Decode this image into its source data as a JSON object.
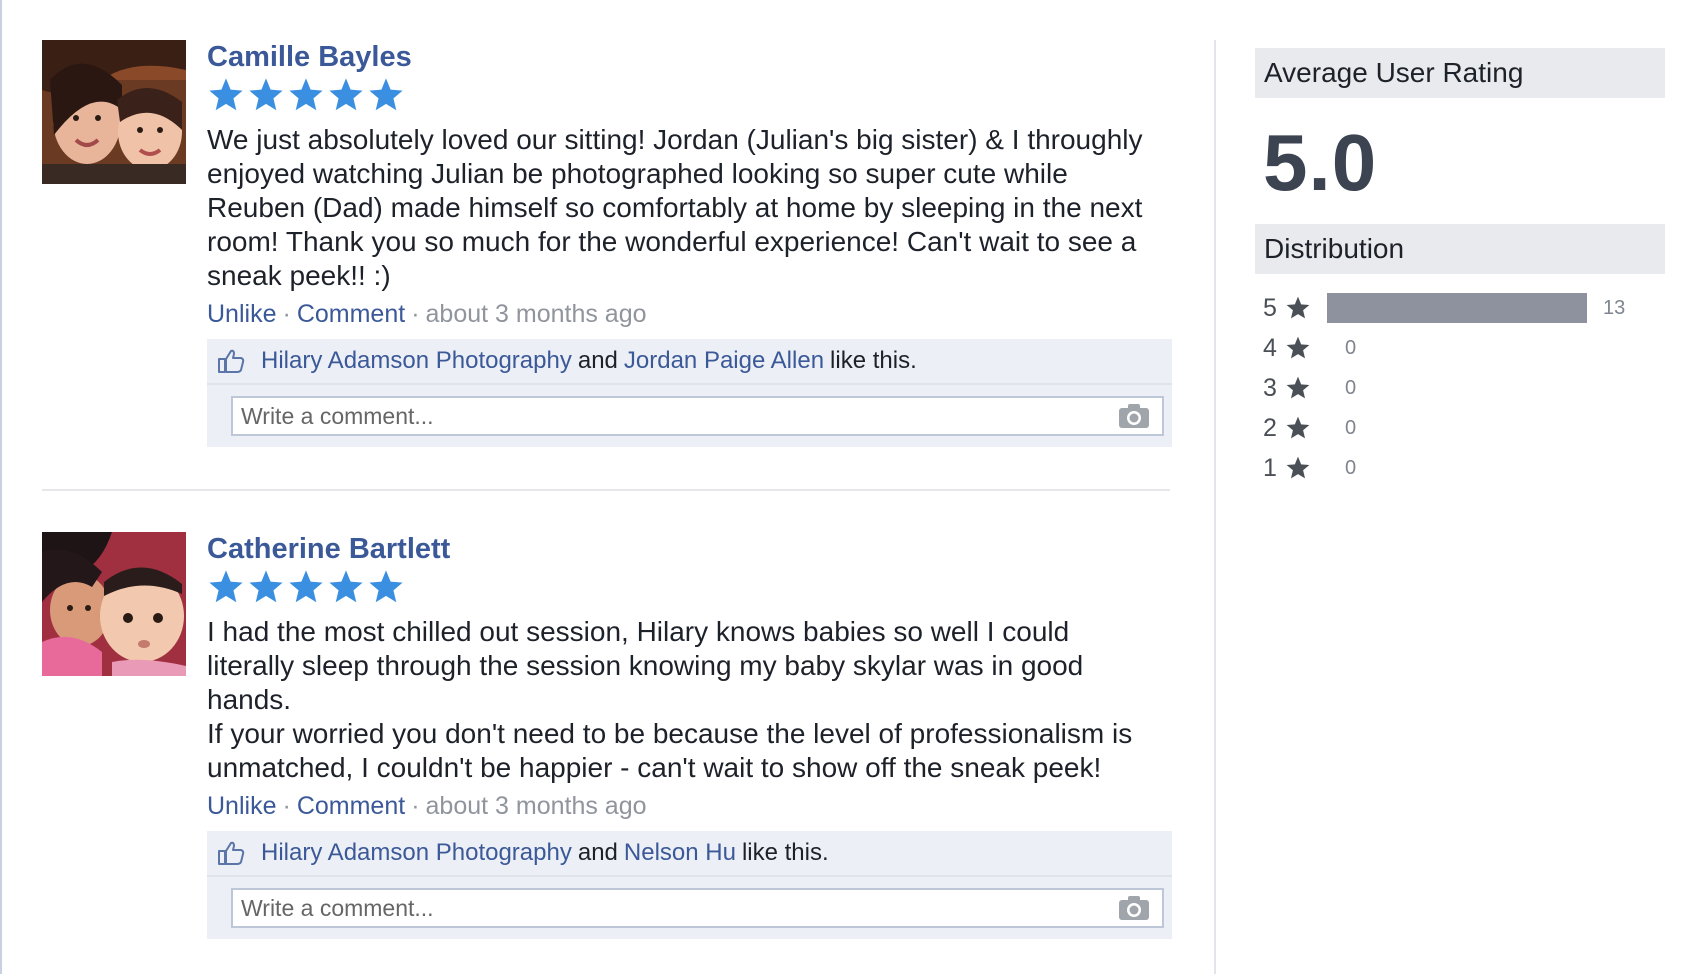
{
  "reviews": [
    {
      "author": "Camille Bayles",
      "rating": 5,
      "text": "We just absolutely loved our sitting! Jordan (Julian's big sister) & I throughly\nenjoyed watching Julian be photographed looking so super cute while\nReuben (Dad) made himself so comfortably at home by sleeping in the next\nroom! Thank you so much for the wonderful experience! Can't wait to see a\nsneak peek!! :)",
      "unlike": "Unlike",
      "comment": "Comment",
      "time": "about 3 months ago",
      "likers": [
        "Hilary Adamson Photography",
        "Jordan Paige Allen"
      ],
      "and": "and",
      "like_this": "like this.",
      "comment_placeholder": "Write a comment..."
    },
    {
      "author": "Catherine Bartlett",
      "rating": 5,
      "text": "I had the most chilled out session, Hilary knows babies so well I could\nliterally sleep through the session knowing my baby skylar was in good\nhands.\nIf your worried you don't need to be because the level of professionalism is\nunmatched, I couldn't be happier - can't wait to show off the sneak peek!",
      "unlike": "Unlike",
      "comment": "Comment",
      "time": "about 3 months ago",
      "likers": [
        "Hilary Adamson Photography",
        "Nelson Hu"
      ],
      "and": "and",
      "like_this": "like this.",
      "comment_placeholder": "Write a comment..."
    }
  ],
  "summary": {
    "average_title": "Average User Rating",
    "average_value": "5.0",
    "distribution_title": "Distribution",
    "distribution": [
      {
        "stars": "5",
        "count": 13
      },
      {
        "stars": "4",
        "count": 0
      },
      {
        "stars": "3",
        "count": 0
      },
      {
        "stars": "2",
        "count": 0
      },
      {
        "stars": "1",
        "count": 0
      }
    ]
  },
  "colors": {
    "link": "#3b5998",
    "star_blue": "#3b8fe0",
    "bar": "#8d929e",
    "panel_header_bg": "#e9eaed"
  },
  "icons": {
    "star": "star-icon",
    "like": "thumbs-up-icon",
    "camera": "camera-icon"
  }
}
